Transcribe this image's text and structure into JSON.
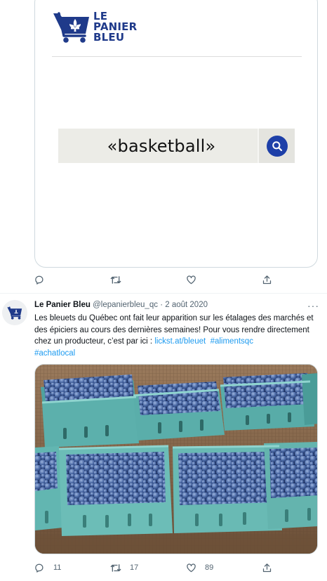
{
  "card": {
    "logo_line1": "LE",
    "logo_line2": "PANIER",
    "logo_line3": "BLEU",
    "search_text": "«basketball»",
    "brand_color": "#1f3a8a"
  },
  "card_actions": {
    "reply_icon": "reply-icon",
    "retweet_icon": "retweet-icon",
    "like_icon": "heart-icon",
    "share_icon": "share-icon"
  },
  "tweet": {
    "name": "Le Panier Bleu",
    "handle": "@lepanierbleu_qc",
    "separator": "·",
    "date": "2 août 2020",
    "more": "···",
    "text_main": "Les bleuets du Québec ont fait leur apparition sur les étalages des marchés et des épiciers au cours des dernières semaines! Pour vous rendre directement chez un producteur, c’est par ici : ",
    "link": "lickst.at/bleuet",
    "hashtag1": "#alimentsqc",
    "hashtag2": "#achatlocal",
    "photo_icon": "blueberries-photo",
    "replies": "11",
    "retweets": "17",
    "likes": "89"
  },
  "colors": {
    "link": "#1d9bf0",
    "muted": "#536471",
    "search_button": "#1d3fa8"
  }
}
